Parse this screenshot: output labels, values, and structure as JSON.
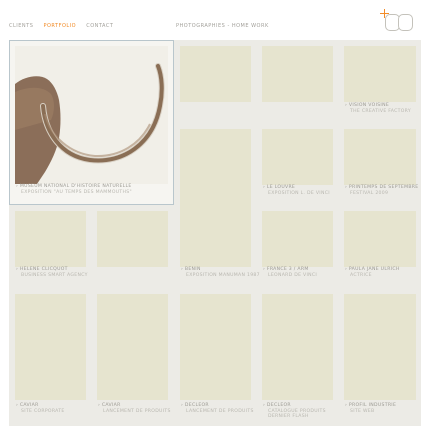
{
  "nav": {
    "items": [
      "CLIENTS",
      "PORTFOLIO",
      "CONTACT"
    ],
    "active_index": 1
  },
  "tagline": "PHOTOGRAPHIES - HOME WORK",
  "accent_color": "#f28c28",
  "icons": {
    "logo": "plus-and-double-ring-logo"
  },
  "projects": [
    {
      "title": "MUSEUM NATIONAL D'HISTOIRE NATURELLE",
      "subtitle": "EXPOSITION \"AU TEMPS DES MAMMOUTHS\""
    },
    {
      "title": "VISION VOISINE",
      "subtitle": "THE CREATIVE FACTORY"
    },
    {
      "title": "LE LOUVRE",
      "subtitle": "EXPOSITION L. DE VINCI"
    },
    {
      "title": "PRINTEMPS DE SEPTEMBRE",
      "subtitle": "FESTIVAL 2009"
    },
    {
      "title": "HELENE CLICQUOT",
      "subtitle": "BUSINESS SMART AGENCY"
    },
    {
      "title": "BENIN",
      "subtitle": "EXPOSITION MANUMAN 1987"
    },
    {
      "title": "FRANCE 3 / ARM",
      "subtitle": "LEONARD DE VINCI"
    },
    {
      "title": "PAULA JANE ULRICH",
      "subtitle": "ACTRICE"
    },
    {
      "title": "CAVIAR",
      "subtitle": "SITE CORPORATE"
    },
    {
      "title": "CAVIAR",
      "subtitle": "LANCEMENT DE PRODUITS"
    },
    {
      "title": "DECLEOR",
      "subtitle": "LANCEMENT DE PRODUITS"
    },
    {
      "title": "DECLEOR",
      "subtitle": "CATALOGUE PRODUITS DERNIER FLASH"
    },
    {
      "title": "PROFIL INDUSTRIE",
      "subtitle": "SITE WEB"
    }
  ]
}
